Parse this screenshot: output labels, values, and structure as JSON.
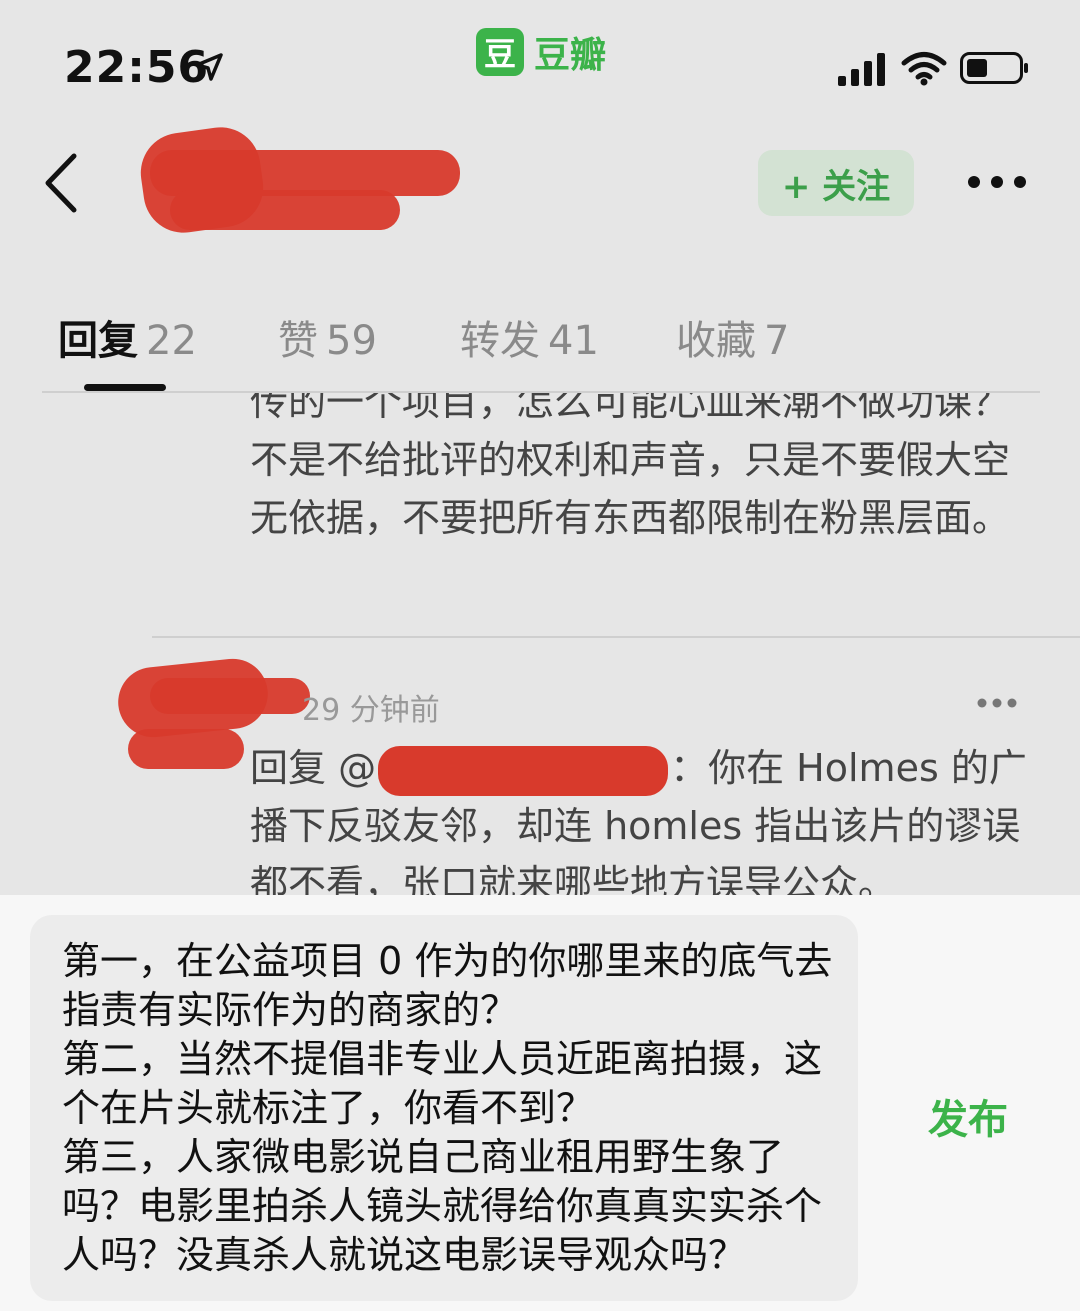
{
  "status_bar": {
    "time": "22:56",
    "app_logo_char": "豆",
    "app_name": "豆瓣",
    "icons": [
      "location-arrow-icon",
      "signal-icon",
      "wifi-icon",
      "battery-icon"
    ]
  },
  "nav": {
    "follow_label": "+ 关注",
    "icons": [
      "back-chevron-icon",
      "more-icon"
    ]
  },
  "tabs": [
    {
      "label": "回复",
      "count": "22",
      "active": true
    },
    {
      "label": "赞",
      "count": "59",
      "active": false
    },
    {
      "label": "转发",
      "count": "41",
      "active": false
    },
    {
      "label": "收藏",
      "count": "7",
      "active": false
    }
  ],
  "comments": {
    "first": {
      "text": "传的一个项目，怎么可能心血来潮不做功课？不是不给批评的权利和声音，只是不要假大空无依据，不要把所有东西都限制在粉黑层面。"
    },
    "second": {
      "time": "29 分钟前",
      "reply_prefix": "回复 @",
      "text": "：你在 Holmes 的广播下反驳友邻，却连 homles 指出该片的谬误都不看，张口就来哪些地方误导公众。"
    }
  },
  "composer": {
    "draft": "第一，在公益项目 0 作为的你哪里来的底气去指责有实际作为的商家的？\n第二，当然不提倡非专业人员近距离拍摄，这个在片头就标注了，你看不到？\n第三，人家微电影说自己商业租用野生象了吗？电影里拍杀人镜头就得给你真真实实杀个人吗？没真杀人就说这电影误导观众吗？",
    "publish_label": "发布"
  },
  "colors": {
    "accent_green": "#3cb34a",
    "redaction": "#d83a2c",
    "background": "#e6e6e6"
  }
}
